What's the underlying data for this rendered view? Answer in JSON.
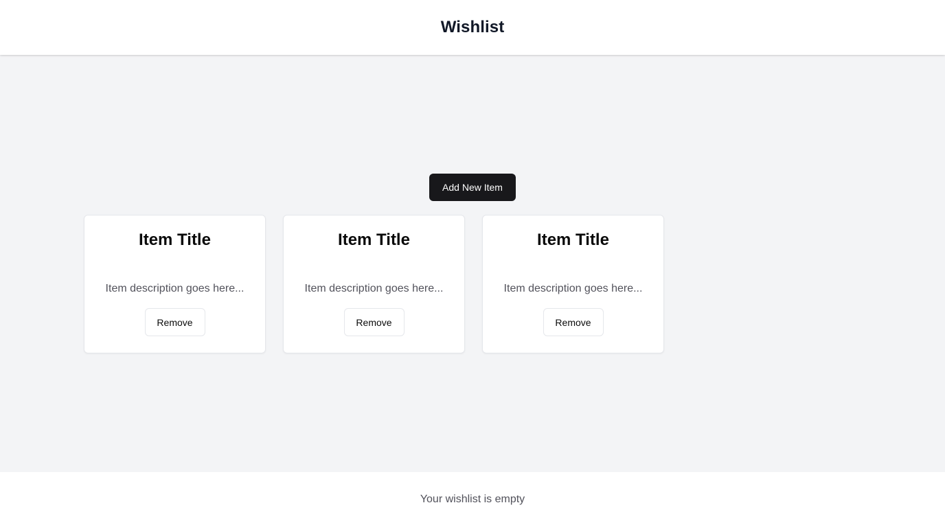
{
  "header": {
    "title": "Wishlist"
  },
  "actions": {
    "add_label": "Add New Item"
  },
  "items": [
    {
      "title": "Item Title",
      "description": "Item description goes here...",
      "remove_label": "Remove"
    },
    {
      "title": "Item Title",
      "description": "Item description goes here...",
      "remove_label": "Remove"
    },
    {
      "title": "Item Title",
      "description": "Item description goes here...",
      "remove_label": "Remove"
    }
  ],
  "footer": {
    "status": "Your wishlist is empty"
  },
  "colors": {
    "primary_button": "#18181b",
    "background": "#f3f4f6",
    "surface": "#ffffff"
  }
}
